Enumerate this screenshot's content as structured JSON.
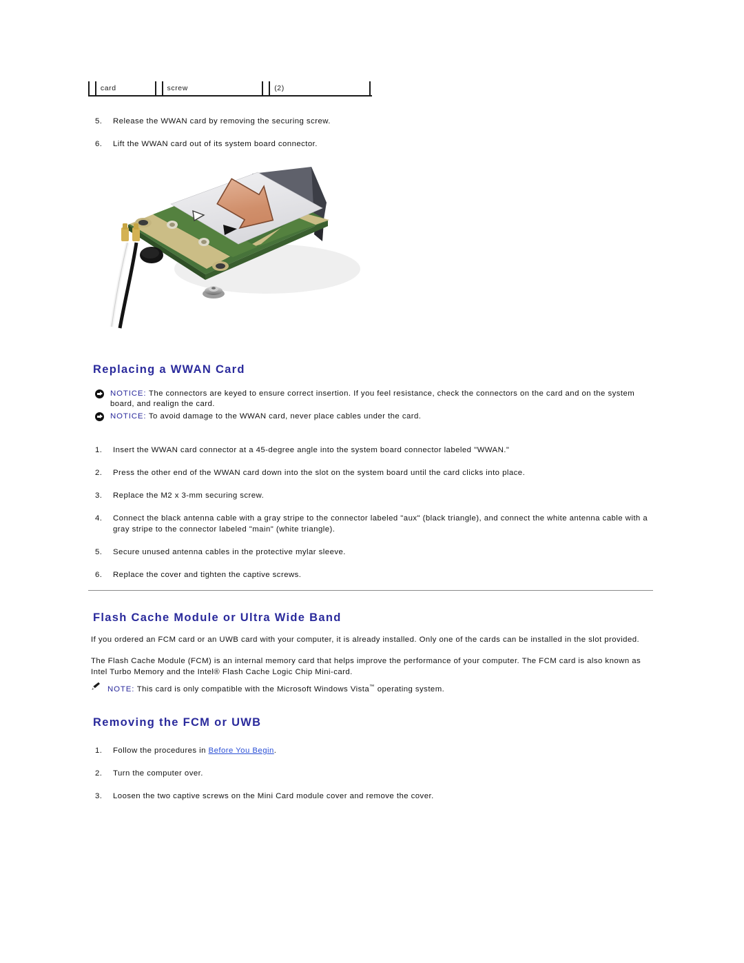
{
  "document": {
    "type": "service-manual-page",
    "background_color": "#ffffff",
    "heading_color": "#2a2a9c",
    "link_color": "#2a4fd6",
    "body_color": "#111111"
  },
  "callout_table": {
    "cells": [
      {
        "num": "",
        "label": "card"
      },
      {
        "num": "",
        "label": "screw"
      },
      {
        "num": "",
        "label": "(2)"
      }
    ]
  },
  "removal_steps_tail": {
    "items": [
      {
        "num": "5.",
        "text": "Release the WWAN card by removing the securing screw."
      },
      {
        "num": "6.",
        "text": "Lift the WWAN card out of its system board connector."
      }
    ]
  },
  "figure": {
    "name": "wwan-mini-card-removal-illustration",
    "alt": "Exploded view of a WWAN Mini Card being lifted from its system board connector, with antenna cables, mylar sleeve, rubber pad and securing screw",
    "colors": {
      "card_label": "#e8e8ea",
      "pcb_green": "#4d7a3d",
      "pcb_edge": "#c9c28a",
      "gold_contact": "#c9a23a",
      "mylar_sleeve": "#5a5c66",
      "arrow_fill": "#d9997a",
      "screw_silver": "#b8b8b8",
      "rubber_pad": "#1a1a1a",
      "cable_white": "#f2f2f2",
      "cable_black": "#151515"
    },
    "markers": {
      "white_triangle": "main",
      "black_triangle": "aux"
    }
  },
  "replacing_section": {
    "heading": "Replacing a WWAN Card",
    "notices": [
      {
        "icon": "notice-arrow-icon",
        "label": "NOTICE:",
        "text": " The connectors are keyed to ensure correct insertion. If you feel resistance, check the connectors on the card and on the system board, and realign the card."
      },
      {
        "icon": "notice-arrow-icon",
        "label": "NOTICE:",
        "text": " To avoid damage to the WWAN card, never place cables under the card."
      }
    ],
    "steps": [
      {
        "num": "1.",
        "text": "Insert the WWAN card connector at a 45-degree angle into the system board connector labeled \"WWAN.\""
      },
      {
        "num": "2.",
        "text": "Press the other end of the WWAN card down into the slot on the system board until the card clicks into place."
      },
      {
        "num": "3.",
        "text": "Replace the M2 x 3-mm securing screw."
      },
      {
        "num": "4.",
        "text": "Connect the black antenna cable with a gray stripe to the connector labeled \"aux\" (black triangle), and connect the white antenna cable with a gray stripe to the connector labeled \"main\" (white triangle)."
      },
      {
        "num": "5.",
        "text": "Secure unused antenna cables in the protective mylar sleeve."
      },
      {
        "num": "6.",
        "text": "Replace the cover and tighten the captive screws."
      }
    ]
  },
  "flash_cache_section": {
    "heading": "Flash Cache Module or Ultra Wide Band",
    "paragraph_1": "If you ordered an FCM card or an UWB card with your computer, it is already installed. Only one of the cards can be installed in the slot provided.",
    "paragraph_2": "The Flash Cache Module (FCM) is an internal memory card that helps improve the performance of your computer. The FCM card is also known as Intel Turbo Memory and the Intel® Flash Cache Logic Chip Mini-card.",
    "note": {
      "icon": "note-pencil-icon",
      "label": "NOTE:",
      "text_before": " This card is only compatible with the Microsoft Windows Vista",
      "trademark": "™",
      "text_after": " operating system."
    }
  },
  "removing_section": {
    "heading": "Removing the FCM or UWB",
    "steps": [
      {
        "num": "1.",
        "text_before": "Follow the procedures in ",
        "link": "Before You Begin",
        "text_after": "."
      },
      {
        "num": "2.",
        "text": "Turn the computer over."
      },
      {
        "num": "3.",
        "text": "Loosen the two captive screws on the Mini Card module cover and remove the cover."
      }
    ]
  }
}
